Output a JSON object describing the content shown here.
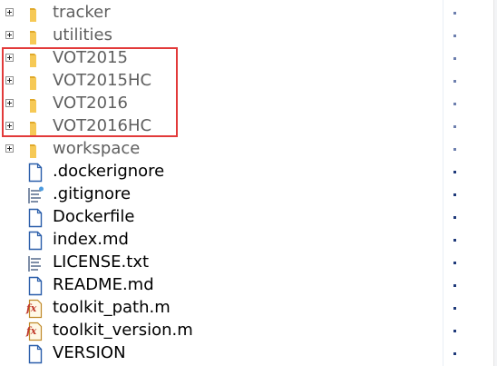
{
  "tree": {
    "folders": [
      {
        "label": "tracker",
        "icon": "folder-icon"
      },
      {
        "label": "utilities",
        "icon": "folder-icon"
      },
      {
        "label": "VOT2015",
        "icon": "folder-icon"
      },
      {
        "label": "VOT2015HC",
        "icon": "folder-icon"
      },
      {
        "label": "VOT2016",
        "icon": "folder-icon"
      },
      {
        "label": "VOT2016HC",
        "icon": "folder-icon"
      },
      {
        "label": "workspace",
        "icon": "folder-icon"
      }
    ],
    "files": [
      {
        "label": ".dockerignore",
        "icon": "document-icon"
      },
      {
        "label": ".gitignore",
        "icon": "git-file-icon"
      },
      {
        "label": "Dockerfile",
        "icon": "document-icon"
      },
      {
        "label": "index.md",
        "icon": "document-icon"
      },
      {
        "label": "LICENSE.txt",
        "icon": "text-file-icon"
      },
      {
        "label": "README.md",
        "icon": "document-icon"
      },
      {
        "label": "toolkit_path.m",
        "icon": "matlab-function-icon"
      },
      {
        "label": "toolkit_version.m",
        "icon": "matlab-function-icon"
      },
      {
        "label": "VERSION",
        "icon": "document-icon"
      }
    ]
  },
  "highlight": {
    "color": "#e23a3a"
  },
  "colors": {
    "folder": "#f6c956",
    "folder_dark": "#e0a92b",
    "document_border": "#2a5eaa",
    "highlight": "#e23a3a"
  }
}
